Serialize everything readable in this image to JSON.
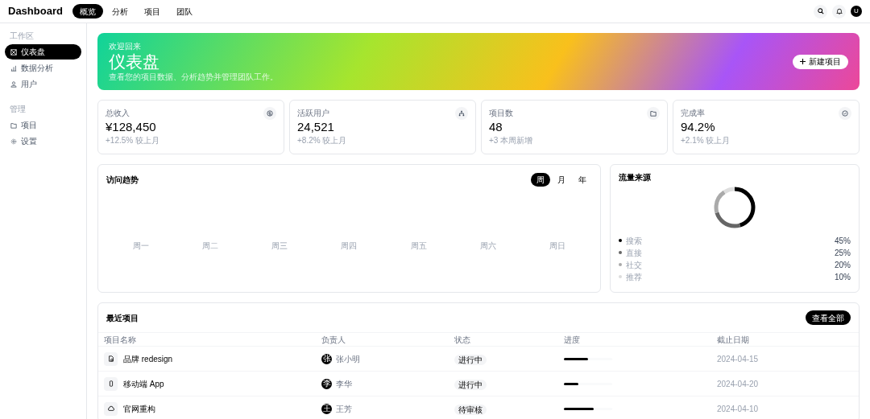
{
  "header": {
    "brand": "Dashboard",
    "tabs": [
      {
        "label": "概览",
        "selected": true
      },
      {
        "label": "分析",
        "selected": false
      },
      {
        "label": "项目",
        "selected": false
      },
      {
        "label": "团队",
        "selected": false
      }
    ],
    "avatar": "U"
  },
  "sidebar": {
    "sections": [
      {
        "title": "工作区",
        "items": [
          {
            "label": "仪表盘",
            "selected": true
          },
          {
            "label": "数据分析",
            "selected": false
          },
          {
            "label": "用户",
            "selected": false
          }
        ]
      },
      {
        "title": "管理",
        "items": [
          {
            "label": "项目",
            "selected": false
          },
          {
            "label": "设置",
            "selected": false
          }
        ]
      }
    ]
  },
  "hero": {
    "eyebrow": "欢迎回来",
    "title": "仪表盘",
    "subtitle": "查看您的项目数据、分析趋势并管理团队工作。",
    "button": "新建项目"
  },
  "stats": [
    {
      "label": "总收入",
      "value": "¥128,450",
      "change": "+12.5% 较上月"
    },
    {
      "label": "活跃用户",
      "value": "24,521",
      "change": "+8.2% 较上月"
    },
    {
      "label": "项目数",
      "value": "48",
      "change": "+3 本周新增"
    },
    {
      "label": "完成率",
      "value": "94.2%",
      "change": "+2.1% 较上月"
    }
  ],
  "trend": {
    "title": "访问趋势",
    "ranges": [
      {
        "label": "周",
        "selected": true
      },
      {
        "label": "月",
        "selected": false
      },
      {
        "label": "年",
        "selected": false
      }
    ],
    "x_labels": [
      "周一",
      "周二",
      "周三",
      "周四",
      "周五",
      "周六",
      "周日"
    ]
  },
  "traffic": {
    "title": "流量来源",
    "sources": [
      {
        "label": "搜索",
        "value": "45%",
        "color": "#000000"
      },
      {
        "label": "直接",
        "value": "25%",
        "color": "#666666"
      },
      {
        "label": "社交",
        "value": "20%",
        "color": "#aaaaaa"
      },
      {
        "label": "推荐",
        "value": "10%",
        "color": "#dddddd"
      }
    ]
  },
  "projects": {
    "title": "最近项目",
    "button": "查看全部",
    "columns": [
      "项目名称",
      "负责人",
      "状态",
      "进度",
      "截止日期"
    ],
    "rows": [
      {
        "name": "品牌 redesign",
        "owner_initial": "张",
        "owner": "张小明",
        "status": "进行中",
        "level": 0.5,
        "due": "2024-04-15"
      },
      {
        "name": "移动端 App",
        "owner_initial": "李",
        "owner": "李华",
        "status": "进行中",
        "level": 0.3,
        "due": "2024-04-20"
      },
      {
        "name": "官网重构",
        "owner_initial": "王",
        "owner": "王芳",
        "status": "待审核",
        "level": 0.62,
        "due": "2024-04-10"
      }
    ]
  }
}
